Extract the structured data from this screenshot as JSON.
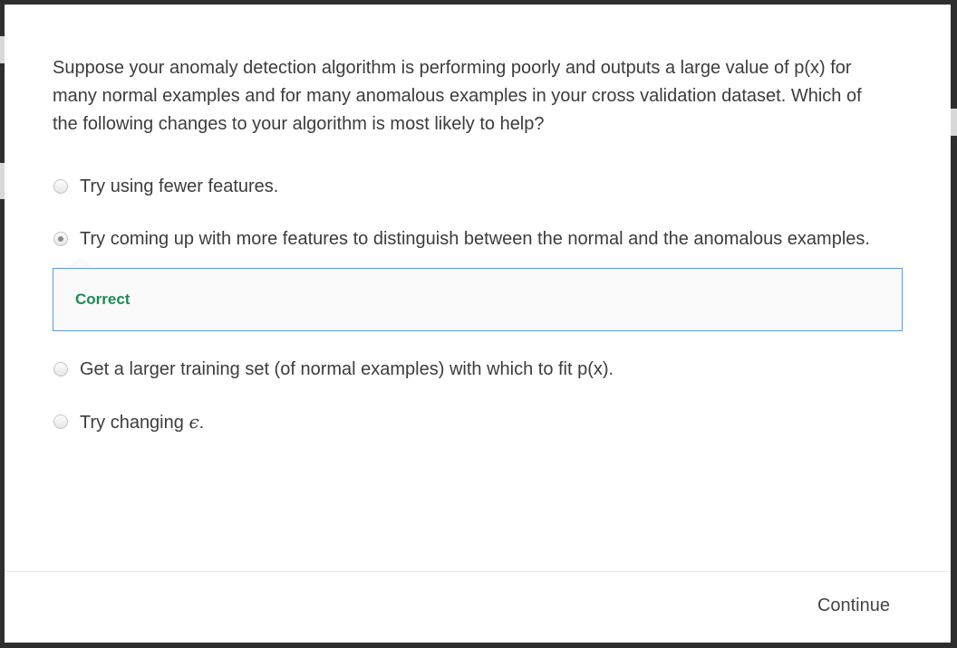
{
  "question": {
    "text": "Suppose your anomaly detection algorithm is performing poorly and outputs a large value of p(x) for many normal examples and for many anomalous examples in your cross validation dataset. Which of the following changes to your algorithm is most likely to help?"
  },
  "options": [
    {
      "label": "Try using fewer features.",
      "selected": false
    },
    {
      "label": "Try coming up with more features to distinguish between the normal and the anomalous examples.",
      "selected": true
    },
    {
      "label": "Get a larger training set (of normal examples) with which to fit p(x).",
      "selected": false
    },
    {
      "label_prefix": "Try changing ",
      "label_symbol": "ϵ",
      "label_suffix": ".",
      "selected": false
    }
  ],
  "feedback": {
    "label": "Correct",
    "color": "#1f8a53",
    "border_color": "#5b9ae5"
  },
  "footer": {
    "continue_label": "Continue"
  }
}
